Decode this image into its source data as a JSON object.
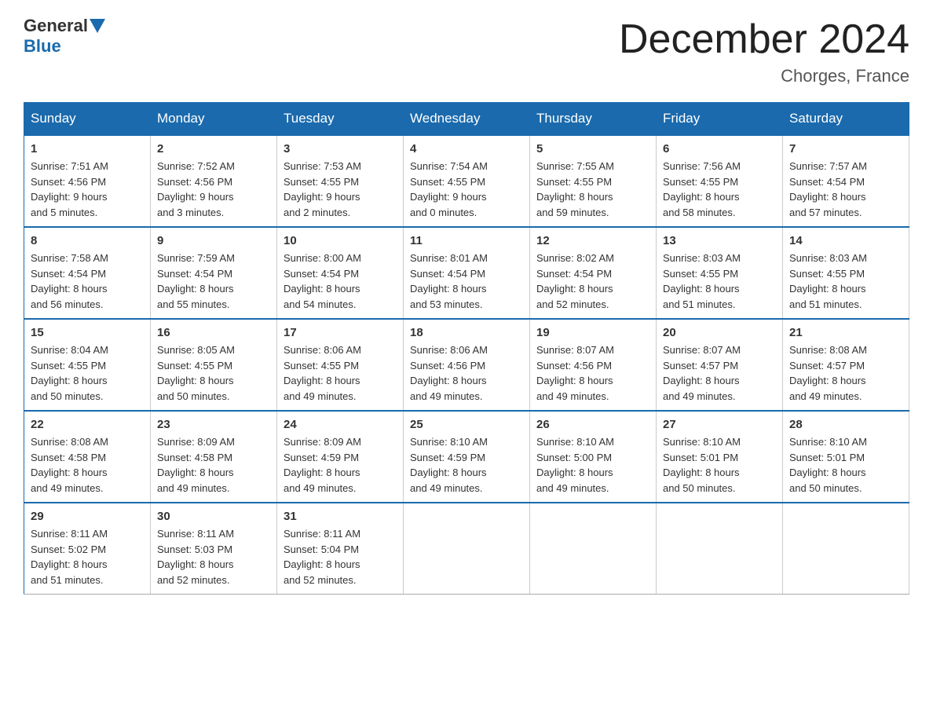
{
  "header": {
    "logo_general": "General",
    "logo_blue": "Blue",
    "month_title": "December 2024",
    "location": "Chorges, France"
  },
  "days_of_week": [
    "Sunday",
    "Monday",
    "Tuesday",
    "Wednesday",
    "Thursday",
    "Friday",
    "Saturday"
  ],
  "weeks": [
    [
      {
        "day": "1",
        "sunrise": "7:51 AM",
        "sunset": "4:56 PM",
        "daylight": "9 hours and 5 minutes."
      },
      {
        "day": "2",
        "sunrise": "7:52 AM",
        "sunset": "4:56 PM",
        "daylight": "9 hours and 3 minutes."
      },
      {
        "day": "3",
        "sunrise": "7:53 AM",
        "sunset": "4:55 PM",
        "daylight": "9 hours and 2 minutes."
      },
      {
        "day": "4",
        "sunrise": "7:54 AM",
        "sunset": "4:55 PM",
        "daylight": "9 hours and 0 minutes."
      },
      {
        "day": "5",
        "sunrise": "7:55 AM",
        "sunset": "4:55 PM",
        "daylight": "8 hours and 59 minutes."
      },
      {
        "day": "6",
        "sunrise": "7:56 AM",
        "sunset": "4:55 PM",
        "daylight": "8 hours and 58 minutes."
      },
      {
        "day": "7",
        "sunrise": "7:57 AM",
        "sunset": "4:54 PM",
        "daylight": "8 hours and 57 minutes."
      }
    ],
    [
      {
        "day": "8",
        "sunrise": "7:58 AM",
        "sunset": "4:54 PM",
        "daylight": "8 hours and 56 minutes."
      },
      {
        "day": "9",
        "sunrise": "7:59 AM",
        "sunset": "4:54 PM",
        "daylight": "8 hours and 55 minutes."
      },
      {
        "day": "10",
        "sunrise": "8:00 AM",
        "sunset": "4:54 PM",
        "daylight": "8 hours and 54 minutes."
      },
      {
        "day": "11",
        "sunrise": "8:01 AM",
        "sunset": "4:54 PM",
        "daylight": "8 hours and 53 minutes."
      },
      {
        "day": "12",
        "sunrise": "8:02 AM",
        "sunset": "4:54 PM",
        "daylight": "8 hours and 52 minutes."
      },
      {
        "day": "13",
        "sunrise": "8:03 AM",
        "sunset": "4:55 PM",
        "daylight": "8 hours and 51 minutes."
      },
      {
        "day": "14",
        "sunrise": "8:03 AM",
        "sunset": "4:55 PM",
        "daylight": "8 hours and 51 minutes."
      }
    ],
    [
      {
        "day": "15",
        "sunrise": "8:04 AM",
        "sunset": "4:55 PM",
        "daylight": "8 hours and 50 minutes."
      },
      {
        "day": "16",
        "sunrise": "8:05 AM",
        "sunset": "4:55 PM",
        "daylight": "8 hours and 50 minutes."
      },
      {
        "day": "17",
        "sunrise": "8:06 AM",
        "sunset": "4:55 PM",
        "daylight": "8 hours and 49 minutes."
      },
      {
        "day": "18",
        "sunrise": "8:06 AM",
        "sunset": "4:56 PM",
        "daylight": "8 hours and 49 minutes."
      },
      {
        "day": "19",
        "sunrise": "8:07 AM",
        "sunset": "4:56 PM",
        "daylight": "8 hours and 49 minutes."
      },
      {
        "day": "20",
        "sunrise": "8:07 AM",
        "sunset": "4:57 PM",
        "daylight": "8 hours and 49 minutes."
      },
      {
        "day": "21",
        "sunrise": "8:08 AM",
        "sunset": "4:57 PM",
        "daylight": "8 hours and 49 minutes."
      }
    ],
    [
      {
        "day": "22",
        "sunrise": "8:08 AM",
        "sunset": "4:58 PM",
        "daylight": "8 hours and 49 minutes."
      },
      {
        "day": "23",
        "sunrise": "8:09 AM",
        "sunset": "4:58 PM",
        "daylight": "8 hours and 49 minutes."
      },
      {
        "day": "24",
        "sunrise": "8:09 AM",
        "sunset": "4:59 PM",
        "daylight": "8 hours and 49 minutes."
      },
      {
        "day": "25",
        "sunrise": "8:10 AM",
        "sunset": "4:59 PM",
        "daylight": "8 hours and 49 minutes."
      },
      {
        "day": "26",
        "sunrise": "8:10 AM",
        "sunset": "5:00 PM",
        "daylight": "8 hours and 49 minutes."
      },
      {
        "day": "27",
        "sunrise": "8:10 AM",
        "sunset": "5:01 PM",
        "daylight": "8 hours and 50 minutes."
      },
      {
        "day": "28",
        "sunrise": "8:10 AM",
        "sunset": "5:01 PM",
        "daylight": "8 hours and 50 minutes."
      }
    ],
    [
      {
        "day": "29",
        "sunrise": "8:11 AM",
        "sunset": "5:02 PM",
        "daylight": "8 hours and 51 minutes."
      },
      {
        "day": "30",
        "sunrise": "8:11 AM",
        "sunset": "5:03 PM",
        "daylight": "8 hours and 52 minutes."
      },
      {
        "day": "31",
        "sunrise": "8:11 AM",
        "sunset": "5:04 PM",
        "daylight": "8 hours and 52 minutes."
      },
      null,
      null,
      null,
      null
    ]
  ],
  "labels": {
    "sunrise": "Sunrise:",
    "sunset": "Sunset:",
    "daylight": "Daylight:"
  }
}
